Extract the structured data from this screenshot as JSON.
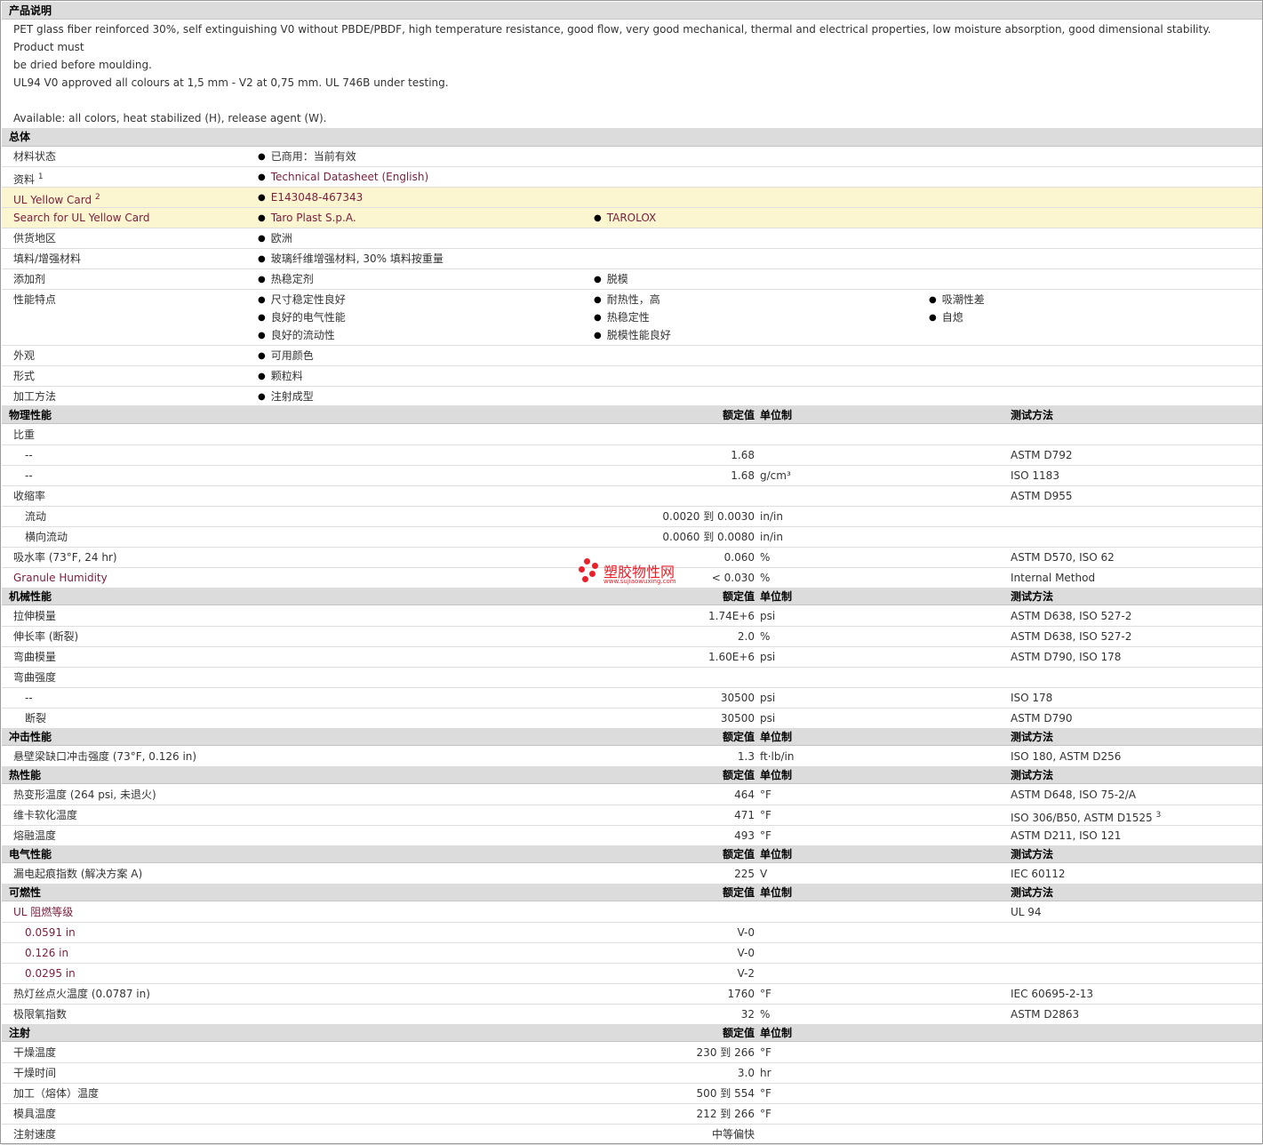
{
  "description": {
    "heading": "产品说明",
    "p1": "PET glass fiber reinforced 30%, self extinguishing V0 without PBDE/PBDF, high temperature resistance, good flow, very good mechanical, thermal and electrical properties, low moisture absorption, good dimensional stability. Product must",
    "p1b": "be dried before moulding.",
    "p2": "UL94 V0 approved all colours at 1,5 mm - V2 at 0,75 mm. UL 746B under testing.",
    "p3": "Available: all colors, heat stabilized (H), release agent (W)."
  },
  "general": {
    "heading": "总体",
    "status_label": "材料状态",
    "status_value": "已商用：当前有效",
    "docs_label": "资料",
    "docs_sup": "1",
    "docs_value": "Technical Datasheet (English)",
    "ulcard_label": "UL Yellow Card",
    "ulcard_sup": "2",
    "ulcard_value": "E143048-467343",
    "search_label": "Search for UL Yellow Card",
    "search_v1": "Taro Plast S.p.A.",
    "search_v2": "TAROLOX",
    "region_label": "供货地区",
    "region_value": "欧洲",
    "filler_label": "填料/增强材料",
    "filler_value": "玻璃纤维增强材料, 30% 填料按重量",
    "additive_label": "添加剂",
    "additive_v1": "热稳定剂",
    "additive_v2": "脱模",
    "features_label": "性能特点",
    "features": [
      "尺寸稳定性良好",
      "良好的电气性能",
      "良好的流动性",
      "耐热性，高",
      "热稳定性",
      "脱模性能良好",
      "吸潮性差",
      "自熄"
    ],
    "appearance_label": "外观",
    "appearance_value": "可用颜色",
    "form_label": "形式",
    "form_value": "颗粒料",
    "process_label": "加工方法",
    "process_value": "注射成型"
  },
  "headers": {
    "nominal": "额定值",
    "unit": "单位制",
    "method": "测试方法"
  },
  "physical": {
    "heading": "物理性能",
    "rows": [
      {
        "label": "比重",
        "value": "",
        "unit": "",
        "method": "",
        "indent": false
      },
      {
        "label": "--",
        "value": "1.68",
        "unit": "",
        "method": "ASTM D792",
        "indent": true
      },
      {
        "label": "--",
        "value": "1.68",
        "unit": "g/cm³",
        "method": "ISO 1183",
        "indent": true
      },
      {
        "label": "收缩率",
        "value": "",
        "unit": "",
        "method": "ASTM D955",
        "indent": false
      },
      {
        "label": "流动",
        "value": "0.0020 到  0.0030",
        "unit": "in/in",
        "method": "",
        "indent": true
      },
      {
        "label": "横向流动",
        "value": "0.0060 到  0.0080",
        "unit": "in/in",
        "method": "",
        "indent": true
      },
      {
        "label": "吸水率  (73°F, 24 hr)",
        "value": "0.060",
        "unit": "%",
        "method": "ASTM D570, ISO 62",
        "indent": false
      },
      {
        "label": "Granule Humidity",
        "value": "< 0.030",
        "unit": "%",
        "method": "Internal Method",
        "indent": false,
        "link": true
      }
    ]
  },
  "mechanical": {
    "heading": "机械性能",
    "rows": [
      {
        "label": "拉伸模量",
        "value": "1.74E+6",
        "unit": "psi",
        "method": "ASTM D638, ISO 527-2",
        "indent": false
      },
      {
        "label": "伸长率  (断裂)",
        "value": "2.0",
        "unit": "%",
        "method": "ASTM D638, ISO 527-2",
        "indent": false
      },
      {
        "label": "弯曲模量",
        "value": "1.60E+6",
        "unit": "psi",
        "method": "ASTM D790, ISO 178",
        "indent": false
      },
      {
        "label": "弯曲强度",
        "value": "",
        "unit": "",
        "method": "",
        "indent": false
      },
      {
        "label": "--",
        "value": "30500",
        "unit": "psi",
        "method": "ISO 178",
        "indent": true
      },
      {
        "label": "断裂",
        "value": "30500",
        "unit": "psi",
        "method": "ASTM D790",
        "indent": true
      }
    ]
  },
  "impact": {
    "heading": "冲击性能",
    "rows": [
      {
        "label": "悬壁梁缺口冲击强度  (73°F, 0.126 in)",
        "value": "1.3",
        "unit": "ft·lb/in",
        "method": "ISO 180, ASTM D256",
        "indent": false
      }
    ]
  },
  "thermal": {
    "heading": "热性能",
    "rows": [
      {
        "label": "热变形温度  (264 psi, 未退火)",
        "value": "464",
        "unit": "°F",
        "method": "ASTM D648, ISO 75-2/A",
        "indent": false
      },
      {
        "label": "维卡软化温度",
        "value": "471",
        "unit": "°F",
        "method": "ISO 306/B50, ASTM D1525",
        "sup": "3",
        "indent": false
      },
      {
        "label": "熔融温度",
        "value": "493",
        "unit": "°F",
        "method": "ASTM D211, ISO 121",
        "indent": false
      }
    ]
  },
  "electrical": {
    "heading": "电气性能",
    "rows": [
      {
        "label": "漏电起痕指数  (解决方案  A)",
        "value": "225",
        "unit": "V",
        "method": "IEC 60112",
        "indent": false
      }
    ]
  },
  "flammability": {
    "heading": "可燃性",
    "rows": [
      {
        "label": "UL 阻燃等级",
        "value": "",
        "unit": "",
        "method": "UL 94",
        "indent": false,
        "link": true
      },
      {
        "label": "0.0591 in",
        "value": "V-0",
        "unit": "",
        "method": "",
        "indent": true,
        "link": true
      },
      {
        "label": "0.126 in",
        "value": "V-0",
        "unit": "",
        "method": "",
        "indent": true,
        "link": true
      },
      {
        "label": "0.0295 in",
        "value": "V-2",
        "unit": "",
        "method": "",
        "indent": true,
        "link": true
      },
      {
        "label": "热灯丝点火温度  (0.0787 in)",
        "value": "1760",
        "unit": "°F",
        "method": "IEC 60695-2-13",
        "indent": false
      },
      {
        "label": "极限氧指数",
        "value": "32",
        "unit": "%",
        "method": "ASTM D2863",
        "indent": false
      }
    ]
  },
  "injection": {
    "heading": "注射",
    "rows": [
      {
        "label": "干燥温度",
        "value": "230 到  266",
        "unit": "°F",
        "method": "",
        "indent": false
      },
      {
        "label": "干燥时间",
        "value": "3.0",
        "unit": "hr",
        "method": "",
        "indent": false
      },
      {
        "label": "加工（熔体）温度",
        "value": "500 到  554",
        "unit": "°F",
        "method": "",
        "indent": false
      },
      {
        "label": "模具温度",
        "value": "212 到  266",
        "unit": "°F",
        "method": "",
        "indent": false
      },
      {
        "label": "注射速度",
        "value": "中等偏快",
        "unit": "",
        "method": "",
        "indent": false
      }
    ]
  },
  "watermark": {
    "cn": "塑胶物性网",
    "en": "www.sujiaowuxing.com"
  },
  "colors": {
    "section_bg": "#dcdcdc",
    "highlight_bg": "#fbf6cf",
    "link": "#7a1e3e",
    "watermark": "#e8202a"
  }
}
